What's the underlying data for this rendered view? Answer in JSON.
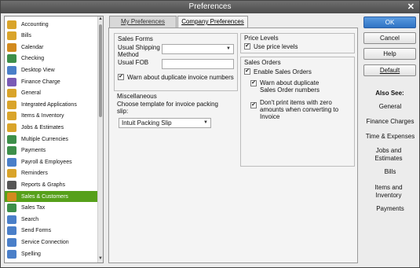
{
  "window": {
    "title": "Preferences",
    "close_glyph": "✕"
  },
  "categories": [
    {
      "label": "Accounting",
      "icon": "accounting-icon",
      "color": "#d9a42a"
    },
    {
      "label": "Bills",
      "icon": "bills-icon",
      "color": "#d9a42a"
    },
    {
      "label": "Calendar",
      "icon": "calendar-icon",
      "color": "#d28a1e"
    },
    {
      "label": "Checking",
      "icon": "checking-icon",
      "color": "#3d8f4a"
    },
    {
      "label": "Desktop View",
      "icon": "desktop-view-icon",
      "color": "#4a7fc9"
    },
    {
      "label": "Finance Charge",
      "icon": "finance-charge-icon",
      "color": "#7a5ab5"
    },
    {
      "label": "General",
      "icon": "general-icon",
      "color": "#d9a42a"
    },
    {
      "label": "Integrated Applications",
      "icon": "integrated-applications-icon",
      "color": "#d9a42a"
    },
    {
      "label": "Items & Inventory",
      "icon": "items-inventory-icon",
      "color": "#d9a42a"
    },
    {
      "label": "Jobs & Estimates",
      "icon": "jobs-estimates-icon",
      "color": "#d9a42a"
    },
    {
      "label": "Multiple Currencies",
      "icon": "multiple-currencies-icon",
      "color": "#3d8f4a"
    },
    {
      "label": "Payments",
      "icon": "payments-icon",
      "color": "#3d8f4a"
    },
    {
      "label": "Payroll & Employees",
      "icon": "payroll-employees-icon",
      "color": "#4a7fc9"
    },
    {
      "label": "Reminders",
      "icon": "reminders-icon",
      "color": "#d9a42a"
    },
    {
      "label": "Reports & Graphs",
      "icon": "reports-graphs-icon",
      "color": "#555555"
    },
    {
      "label": "Sales & Customers",
      "icon": "sales-customers-icon",
      "color": "#d28a1e",
      "selected": true
    },
    {
      "label": "Sales Tax",
      "icon": "sales-tax-icon",
      "color": "#3d8f4a"
    },
    {
      "label": "Search",
      "icon": "search-icon",
      "color": "#4a7fc9"
    },
    {
      "label": "Send Forms",
      "icon": "send-forms-icon",
      "color": "#4a7fc9"
    },
    {
      "label": "Service Connection",
      "icon": "service-connection-icon",
      "color": "#4a7fc9"
    },
    {
      "label": "Spelling",
      "icon": "spelling-icon",
      "color": "#4a7fc9"
    }
  ],
  "tabs": {
    "my_preferences": "My Preferences",
    "company_preferences": "Company Preferences"
  },
  "sales_forms": {
    "title": "Sales Forms",
    "shipping_label": "Usual Shipping Method",
    "shipping_value": "",
    "fob_label": "Usual FOB",
    "fob_value": "",
    "warn_duplicate_invoice": "Warn about duplicate invoice numbers",
    "warn_duplicate_invoice_checked": true
  },
  "miscellaneous": {
    "title": "Miscellaneous",
    "template_label": "Choose template for invoice packing slip:",
    "template_value": "Intuit Packing Slip"
  },
  "price_levels": {
    "title": "Price Levels",
    "use_price_levels": "Use price levels",
    "use_price_levels_checked": true
  },
  "sales_orders": {
    "title": "Sales Orders",
    "enable": "Enable Sales Orders",
    "enable_checked": true,
    "warn_duplicate": "Warn about duplicate Sales Order numbers",
    "warn_duplicate_checked": true,
    "dont_print_zero": "Don't print items with zero amounts when converting to Invoice",
    "dont_print_zero_checked": true
  },
  "buttons": {
    "ok": "OK",
    "cancel": "Cancel",
    "help": "Help",
    "default": "Default"
  },
  "also_see": {
    "title": "Also See:",
    "links": [
      "General",
      "Finance Charges",
      "Time & Expenses",
      "Jobs and Estimates",
      "Bills",
      "Items and Inventory",
      "Payments"
    ]
  }
}
